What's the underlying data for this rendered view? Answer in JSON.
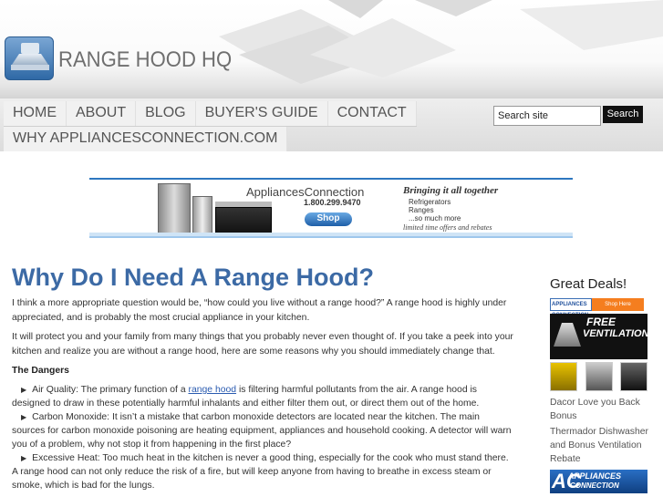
{
  "header": {
    "site_title": "RANGE HOOD HQ"
  },
  "nav": {
    "row1": [
      "HOME",
      "ABOUT",
      "BLOG",
      "BUYER'S GUIDE",
      "CONTACT"
    ],
    "row2": [
      "WHY APPLIANCESCONNECTION.COM"
    ]
  },
  "search": {
    "value": "Search site",
    "button_label": "Search"
  },
  "banner": {
    "brand": "AppliancesConnection",
    "phone": "1.800.299.9470",
    "shop_label": "Shop",
    "tagline": "Bringing it all together",
    "items": [
      "Refrigerators",
      "Ranges",
      "...so much more"
    ],
    "footer": "limited time offers and rebates"
  },
  "article": {
    "title": "Why Do I Need A Range Hood?",
    "para1": "I think a more appropriate question would be, “how could you live without a range hood?” A range hood is highly under appreciated, and is probably the most crucial appliance in your kitchen.",
    "para2": "It will protect you and your family from many things that you probably never even thought of. If you take a peek into your kitchen and realize you are without a range hood, here are some reasons why you should immediately change that.",
    "section_head": "The Dangers",
    "bullet1_pre": "Air Quality: The primary function of a ",
    "bullet1_link": "range hood",
    "bullet1_post": " is filtering harmful pollutants from the air. A range hood is designed to draw in these potentially harmful inhalants and either filter them out, or direct them out of the home.",
    "bullet2": "Carbon Monoxide: It isn’t a mistake that carbon monoxide detectors are located near the kitchen. The main sources for carbon monoxide poisoning are heating equipment, appliances and household cooking. A detector will warn you of a problem, why not stop it from happening in the first place?",
    "bullet3": "Excessive Heat: Too much heat in the kitchen is never a good thing, especially for the cook who must stand there. A range hood can not only reduce the risk of a fire, but will keep anyone from having to breathe in excess steam or smoke, which is bad for the lungs."
  },
  "sidebar": {
    "title": "Great Deals!",
    "ad1_left": "APPLIANCES CONNECTION",
    "ad1_right": "Shop Here",
    "ad2_free": "FREE",
    "ad2_vent": "VENTILATION",
    "link1": "Dacor Love you Back Bonus",
    "link2": "Thermador Dishwasher and Bonus Ventilation Rebate",
    "ad4_t1": "APPLIANCES",
    "ad4_t2": "CONNECTION"
  },
  "colors": {
    "title_blue": "#3c6aa5",
    "link_blue": "#2a5bb0",
    "nav_bg": "#f1f1f1"
  }
}
